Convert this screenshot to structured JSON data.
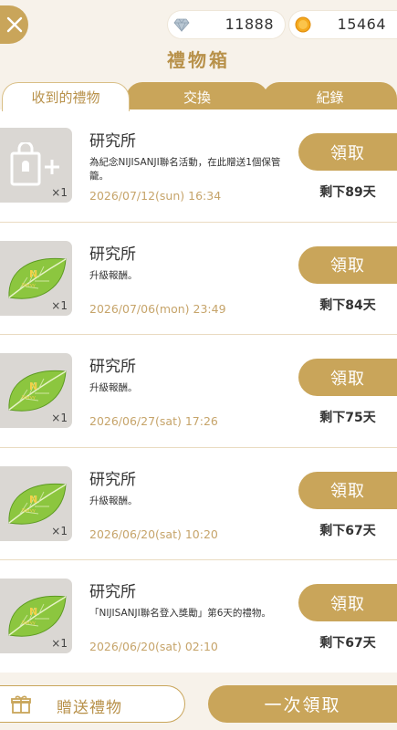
{
  "header": {
    "title": "禮物箱",
    "close_icon": "close-icon",
    "currencies": [
      {
        "name": "gem",
        "icon": "diamond-icon",
        "value": "11888"
      },
      {
        "name": "coin",
        "icon": "coin-icon",
        "value": "15464"
      }
    ]
  },
  "tabs": [
    {
      "label": "收到的禮物",
      "active": true
    },
    {
      "label": "交換",
      "active": false
    },
    {
      "label": "紀錄",
      "active": false
    }
  ],
  "gifts": [
    {
      "icon": "gift-bag-plus-icon",
      "quantity": "×1",
      "sender": "研究所",
      "description": "為紀念NIJISANJI聯名活動，在此贈送1個保管籠。",
      "date": "2026/07/12(sun) 16:34",
      "claim_label": "領取",
      "remaining": "剩下89天"
    },
    {
      "icon": "leaf-icon",
      "quantity": "×1",
      "sender": "研究所",
      "description": "升級報酬。",
      "date": "2026/07/06(mon) 23:49",
      "claim_label": "領取",
      "remaining": "剩下84天"
    },
    {
      "icon": "leaf-icon",
      "quantity": "×1",
      "sender": "研究所",
      "description": "升級報酬。",
      "date": "2026/06/27(sat) 17:26",
      "claim_label": "領取",
      "remaining": "剩下75天"
    },
    {
      "icon": "leaf-icon",
      "quantity": "×1",
      "sender": "研究所",
      "description": "升級報酬。",
      "date": "2026/06/20(sat) 10:20",
      "claim_label": "領取",
      "remaining": "剩下67天"
    },
    {
      "icon": "leaf-icon",
      "quantity": "×1",
      "sender": "研究所",
      "description": "「NIJISANJI聯名登入獎勵」第6天的禮物。",
      "date": "2026/06/20(sat) 02:10",
      "claim_label": "領取",
      "remaining": "剩下67天"
    }
  ],
  "footer": {
    "send_gift_label": "贈送禮物",
    "send_gift_icon": "gift-icon",
    "claim_all_label": "一次領取"
  },
  "colors": {
    "accent_gold": "#c9a55a",
    "title_gold": "#b8914a",
    "date_text": "#c6a46a",
    "leaf_green": "#8cc63f",
    "background": "#f7f2ea"
  }
}
